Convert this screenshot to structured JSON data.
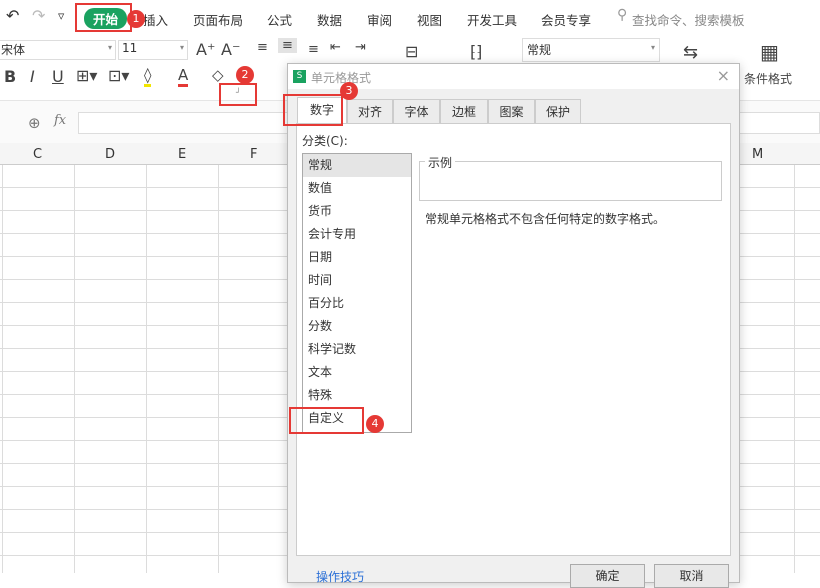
{
  "menu": {
    "undo": "↶",
    "redo": "↷",
    "more": "▿",
    "tabs": [
      "开始",
      "插入",
      "页面布局",
      "公式",
      "数据",
      "审阅",
      "视图",
      "开发工具",
      "会员专享"
    ],
    "search": "查找命令、搜索模板"
  },
  "toolbar": {
    "font": "宋体",
    "size": "11",
    "grow": "A⁺",
    "shrink": "A⁻",
    "bold": "B",
    "italic": "I",
    "underline": "U",
    "number_format": "常规",
    "cond_format": "条件格式"
  },
  "formula": {
    "fx": "fx",
    "value": ""
  },
  "columns": [
    "C",
    "D",
    "E",
    "F",
    "M"
  ],
  "dialog": {
    "title": "单元格格式",
    "close": "×",
    "tabs": [
      "数字",
      "对齐",
      "字体",
      "边框",
      "图案",
      "保护"
    ],
    "category_label": "分类(C):",
    "categories": [
      "常规",
      "数值",
      "货币",
      "会计专用",
      "日期",
      "时间",
      "百分比",
      "分数",
      "科学记数",
      "文本",
      "特殊",
      "自定义"
    ],
    "sample_label": "示例",
    "description": "常规单元格格式不包含任何特定的数字格式。",
    "tips": "操作技巧",
    "ok": "确定",
    "cancel": "取消"
  },
  "annotations": [
    "1",
    "2",
    "3",
    "4"
  ],
  "colors": {
    "accent": "#1aa260",
    "marker": "#e53935"
  }
}
